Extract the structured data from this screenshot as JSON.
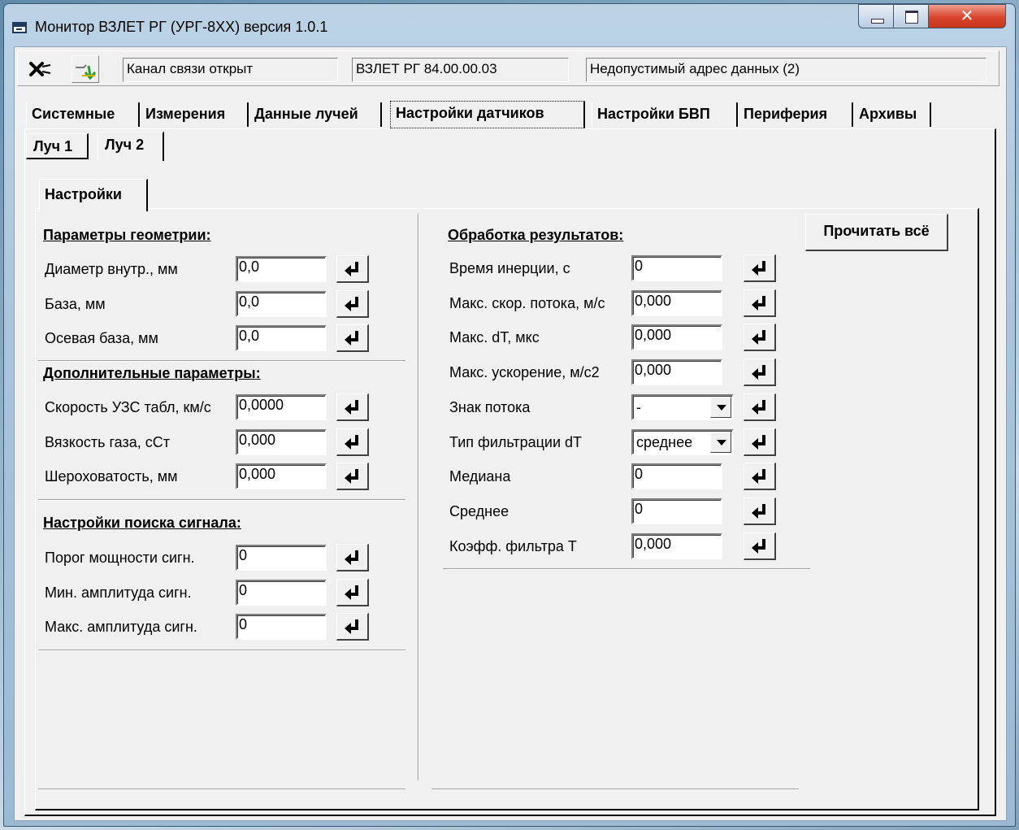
{
  "window": {
    "title": "Монитор ВЗЛЕТ РГ (УРГ-8XX) версия 1.0.1"
  },
  "toolbar": {
    "connection_status": "Канал связи открыт",
    "device_id": "ВЗЛЕТ РГ 84.00.00.03",
    "error_message": "Недопустимый адрес данных (2)"
  },
  "tabs": [
    "Системные",
    "Измерения",
    "Данные лучей",
    "Настройки датчиков",
    "Настройки БВП",
    "Периферия",
    "Архивы"
  ],
  "active_tab": "Настройки датчиков",
  "beam_tabs": [
    "Луч 1",
    "Луч 2"
  ],
  "active_beam_tab": "Луч 2",
  "settings_tab": "Настройки",
  "read_all_button": "Прочитать всё",
  "geometry": {
    "title": "Параметры геометрии:",
    "fields": [
      {
        "label": "Диаметр внутр., мм",
        "value": "0,0"
      },
      {
        "label": "База, мм",
        "value": "0,0"
      },
      {
        "label": "Осевая база, мм",
        "value": "0,0"
      }
    ]
  },
  "additional": {
    "title": "Дополнительные параметры:",
    "fields": [
      {
        "label": "Скорость УЗС табл, км/с",
        "value": "0,0000"
      },
      {
        "label": "Вязкость газа, сСт",
        "value": "0,000"
      },
      {
        "label": "Шероховатость, мм",
        "value": "0,000"
      }
    ]
  },
  "signal_search": {
    "title": "Настройки поиска сигнала:",
    "fields": [
      {
        "label": "Порог мощности сигн.",
        "value": "0"
      },
      {
        "label": "Мин. амплитуда сигн.",
        "value": "0"
      },
      {
        "label": "Макс. амплитуда сигн.",
        "value": "0"
      }
    ]
  },
  "processing": {
    "title": "Обработка результатов:",
    "fields": [
      {
        "label": "Время инерции, с",
        "value": "0"
      },
      {
        "label": "Макс. скор. потока, м/с",
        "value": "0,000"
      },
      {
        "label": "Макс. dT, мкс",
        "value": "0,000"
      },
      {
        "label": "Макс. ускорение, м/с2",
        "value": "0,000"
      },
      {
        "label": "Знак потока",
        "value": "-"
      },
      {
        "label": "Тип фильтрации dT",
        "value": "среднее"
      },
      {
        "label": "Медиана",
        "value": "0"
      },
      {
        "label": "Среднее",
        "value": "0"
      },
      {
        "label": "Коэфф. фильтра Т",
        "value": "0,000"
      }
    ]
  },
  "colors": {
    "title_bar": "#a9c4dc",
    "close_button": "#d9442c",
    "face": "#f0f0f0"
  },
  "icons": {
    "apply": "enter-arrow-icon",
    "connect": "plug-connect-icon",
    "disconnect": "plug-disconnect-icon",
    "dropdown": "dropdown-arrow-icon"
  }
}
